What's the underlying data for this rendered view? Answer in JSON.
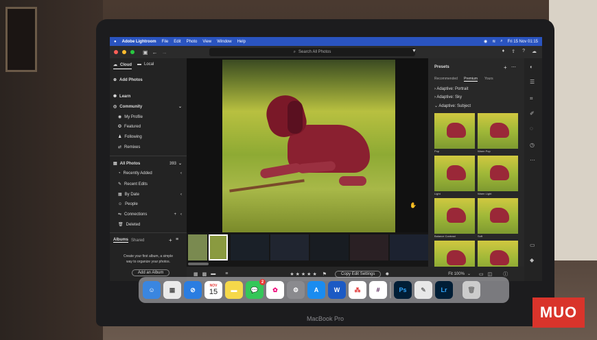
{
  "menubar": {
    "app_name": "Adobe Lightroom",
    "menus": [
      "File",
      "Edit",
      "Photo",
      "View",
      "Window",
      "Help"
    ],
    "clock": "Fri 15 Nov 01:15"
  },
  "toolbar": {
    "search_placeholder": "Search All Photos"
  },
  "sidebar": {
    "tab_cloud": "Cloud",
    "tab_local": "Local",
    "add_photos": "Add Photos",
    "learn": "Learn",
    "community": "Community",
    "my_profile": "My Profile",
    "featured": "Featured",
    "following": "Following",
    "remixes": "Remixes",
    "all_photos": "All Photos",
    "all_photos_count": "393",
    "recently_added": "Recently Added",
    "recent_edits": "Recent Edits",
    "by_date": "By Date",
    "people": "People",
    "connections": "Connections",
    "deleted": "Deleted",
    "albums_tab": "Albums",
    "shared_tab": "Shared",
    "albums_hint_1": "Create your first album, a simple",
    "albums_hint_2": "way to organize your photos.",
    "add_album": "Add an Album"
  },
  "presets": {
    "title": "Presets",
    "tabs": [
      "Recommended",
      "Premium",
      "Yours"
    ],
    "groups": [
      "Adaptive: Portrait",
      "Adaptive: Sky",
      "Adaptive: Subject"
    ],
    "items": [
      "Pop",
      "Warm Pop",
      "Light",
      "Warm Light",
      "Balance Contrast",
      "Soft",
      "",
      ""
    ]
  },
  "bottombar": {
    "copy_edit": "Copy Edit Settings",
    "fit_zoom": "Fit 100%",
    "stars": "★★★★★"
  },
  "dock": {
    "calendar_month": "NOV",
    "calendar_day": "15",
    "messages_badge": "2",
    "ps": "Ps",
    "lr": "Lr"
  },
  "device_label": "MacBook Pro",
  "watermark": "MUO"
}
